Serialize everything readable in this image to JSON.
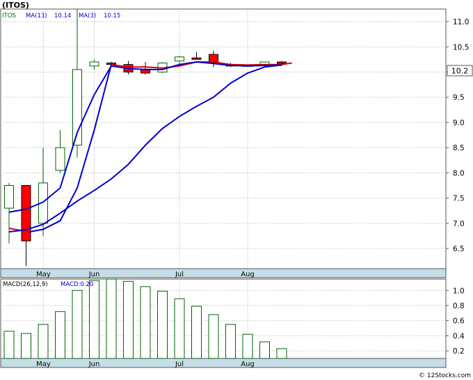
{
  "ticker_title": "(ITOS)",
  "footer": "© 12Stocks.com",
  "colors": {
    "up_candle": "#006400",
    "down_candle": "#ff0000",
    "ma_fast": "#0000cc",
    "ma_slow_down": "#dd0000",
    "macd_bar": "#006400",
    "axis_band": "#c5dde6",
    "grid": "#b0b0b0",
    "price_box": "#ffffff"
  },
  "chart_data": [
    {
      "type": "candlestick",
      "legend": {
        "symbol": "ITOS",
        "ma13_label": "MA(13)",
        "ma13_value": "10.14",
        "ma3_label": "MA(3)",
        "ma3_value": "10.15"
      },
      "last_price_label": "10.2",
      "x_tick_labels": [
        {
          "label": "May",
          "index": 1
        },
        {
          "label": "Jun",
          "index": 5
        },
        {
          "label": "Jul",
          "index": 10
        },
        {
          "label": "Aug",
          "index": 14
        }
      ],
      "ylim": [
        6.1,
        11.25
      ],
      "y_ticks": [
        "6.5",
        "7.0",
        "7.5",
        "8.0",
        "8.5",
        "9.0",
        "9.5",
        "10.0",
        "10.5",
        "11.0"
      ],
      "candles": [
        {
          "open": 7.3,
          "high": 7.8,
          "low": 6.6,
          "close": 7.75
        },
        {
          "open": 7.75,
          "high": 7.75,
          "low": 6.15,
          "close": 6.65
        },
        {
          "open": 7.0,
          "high": 8.5,
          "low": 6.75,
          "close": 7.8
        },
        {
          "open": 8.05,
          "high": 8.85,
          "low": 8.0,
          "close": 8.5
        },
        {
          "open": 8.55,
          "high": 11.25,
          "low": 8.3,
          "close": 10.05
        },
        {
          "open": 10.12,
          "high": 10.25,
          "low": 10.05,
          "close": 10.2
        },
        {
          "open": 10.18,
          "high": 10.2,
          "low": 10.12,
          "close": 10.17
        },
        {
          "open": 10.15,
          "high": 10.22,
          "low": 9.95,
          "close": 10.0
        },
        {
          "open": 10.05,
          "high": 10.2,
          "low": 9.95,
          "close": 9.98
        },
        {
          "open": 10.0,
          "high": 10.2,
          "low": 9.98,
          "close": 10.18
        },
        {
          "open": 10.22,
          "high": 10.32,
          "low": 10.15,
          "close": 10.3
        },
        {
          "open": 10.28,
          "high": 10.4,
          "low": 10.25,
          "close": 10.27
        },
        {
          "open": 10.35,
          "high": 10.42,
          "low": 10.1,
          "close": 10.18
        },
        {
          "open": 10.15,
          "high": 10.18,
          "low": 10.1,
          "close": 10.12
        },
        {
          "open": 10.12,
          "high": 10.15,
          "low": 10.1,
          "close": 10.14
        },
        {
          "open": 10.15,
          "high": 10.2,
          "low": 10.1,
          "close": 10.2
        },
        {
          "open": 10.2,
          "high": 10.22,
          "low": 10.12,
          "close": 10.18
        }
      ],
      "ma3": [
        6.9,
        6.83,
        6.88,
        7.05,
        7.7,
        8.85,
        10.15,
        10.1,
        10.1,
        10.08,
        10.12,
        10.2,
        10.2,
        10.15,
        10.14,
        10.15,
        10.15,
        10.18
      ],
      "ma3_x": [
        0,
        1.2,
        2,
        3,
        4,
        5,
        6,
        7,
        8,
        9,
        10,
        11,
        12,
        13,
        14,
        15,
        16,
        16.6
      ],
      "ma13": [
        7.22,
        7.28,
        7.42,
        7.7,
        8.8,
        9.55,
        10.12,
        10.07,
        10.05,
        10.05,
        10.15,
        10.2,
        10.17,
        10.13,
        10.12,
        10.13,
        10.14
      ],
      "ma13b": [
        6.83,
        6.87,
        6.98,
        7.2,
        7.44,
        7.65,
        7.88,
        8.17,
        8.55,
        8.88,
        9.12,
        9.32,
        9.5,
        9.78,
        9.98,
        10.1,
        10.14
      ]
    },
    {
      "type": "bar",
      "legend": {
        "label": "MACD(26,12,9)",
        "value_label": "MACD:0.20"
      },
      "ylim": [
        0.1,
        1.15
      ],
      "y_ticks": [
        "0.2",
        "0.4",
        "0.6",
        "0.8",
        "1.0"
      ],
      "x_tick_labels": [
        {
          "label": "May",
          "index": 1
        },
        {
          "label": "Jun",
          "index": 5
        },
        {
          "label": "Jul",
          "index": 10
        },
        {
          "label": "Aug",
          "index": 14
        }
      ],
      "values": [
        0.46,
        0.43,
        0.55,
        0.72,
        1.0,
        1.13,
        1.15,
        1.12,
        1.05,
        0.99,
        0.89,
        0.79,
        0.68,
        0.55,
        0.42,
        0.32,
        0.23
      ]
    }
  ]
}
